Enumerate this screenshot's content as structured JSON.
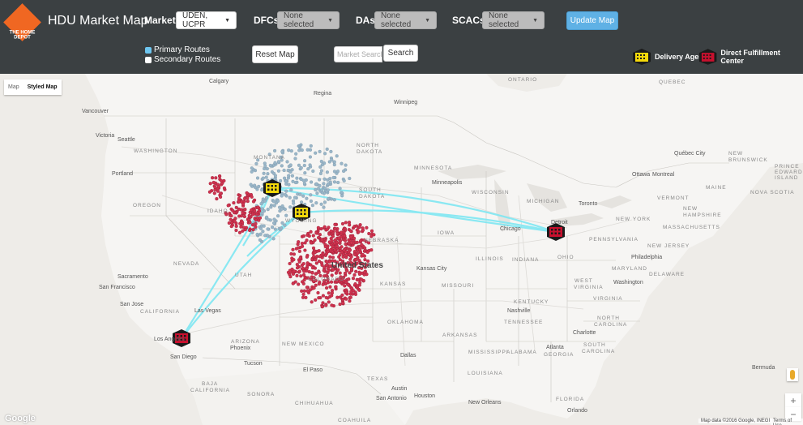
{
  "app": {
    "title": "HDU Market Map",
    "logo_text": "THE HOME DEPOT"
  },
  "filters": {
    "markets_label": "Markets:",
    "markets_value": "UDEN, UCPR",
    "dfcs_label": "DFCs:",
    "dfcs_value": "None selected",
    "das_label": "DAs:",
    "das_value": "None selected",
    "scacs_label": "SCACs:",
    "scacs_value": "None selected",
    "update_label": "Update Map"
  },
  "routes": {
    "primary_label": "Primary Routes",
    "secondary_label": "Secondary Routes",
    "primary_checked": true,
    "secondary_checked": false
  },
  "buttons": {
    "reset_label": "Reset Map",
    "search_label": "Search"
  },
  "search": {
    "placeholder": "Market Search"
  },
  "legend": {
    "delivery_agent": "Delivery Agent",
    "dfc": "Direct Fulfillment Center",
    "delivery_agent_color": "#f5d90a",
    "dfc_color": "#c8102e"
  },
  "map": {
    "type_map": "Map",
    "type_styled": "Styled Map",
    "zoom_in": "+",
    "zoom_out": "−",
    "attribution": "Map data ©2016 Google, INEGI",
    "terms": "Terms of Use",
    "google": "Google",
    "colors": {
      "primary_route": "#7fe7f2",
      "market_red": "#d0334f",
      "market_blue": "#9ab6c8",
      "water": "#eeece8"
    },
    "labels": {
      "calgary": "Calgary",
      "regina": "Regina",
      "winnipeg": "Winnipeg",
      "ontario": "ONTARIO",
      "quebec": "QUEBEC",
      "vancouver": "Vancouver",
      "victoria": "Victoria",
      "seattle": "Seattle",
      "washington": "WASHINGTON",
      "montana": "MONTANA",
      "north_dakota_1": "NORTH",
      "north_dakota_2": "DAKOTA",
      "minnesota": "MINNESOTA",
      "quebec_city": "Québec City",
      "new_brunswick_1": "NEW",
      "new_brunswick_2": "BRUNSWICK",
      "portland": "Portland",
      "oregon": "OREGON",
      "minneapolis": "Minneapolis",
      "wisconsin": "WISCONSIN",
      "ottawa": "Ottawa",
      "montreal": "Montreal",
      "maine": "MAINE",
      "pei_1": "PRINCE",
      "pei_2": "EDWARD",
      "pei_3": "ISLAND",
      "nova_scotia": "NOVA SCOTIA",
      "idaho": "IDAHO",
      "south_dakota_1": "SOUTH",
      "south_dakota_2": "DAKOTA",
      "michigan": "MICHIGAN",
      "toronto": "Toronto",
      "vermont": "VERMONT",
      "new_hampshire_1": "NEW",
      "new_hampshire_2": "HAMPSHIRE",
      "new_york": "NEW YORK",
      "wyoming": "WYOMING",
      "iowa": "IOWA",
      "chicago": "Chicago",
      "detroit": "Detroit",
      "massachusetts": "MASSACHUSETTS",
      "nebraska": "NEBRASKA",
      "pennsylvania": "PENNSYLVANIA",
      "new_jersey": "NEW JERSEY",
      "philadelphia": "Philadelphia",
      "nevada": "NEVADA",
      "utah": "UTAH",
      "united_states": "United States",
      "illinois": "ILLINOIS",
      "indiana": "INDIANA",
      "ohio": "OHIO",
      "colorado": "COLORADO",
      "kansas_city": "Kansas City",
      "maryland": "MARYLAND",
      "delaware": "DELAWARE",
      "sacramento": "Sacramento",
      "san_francisco": "San Francisco",
      "washington_dc": "Washington",
      "kansas": "KANSAS",
      "missouri": "MISSOURI",
      "west_virginia_1": "WEST",
      "west_virginia_2": "VIRGINIA",
      "san_jose": "San Jose",
      "virginia": "VIRGINIA",
      "california": "CALIFORNIA",
      "las_vegas": "Las Vegas",
      "kentucky": "KENTUCKY",
      "nashville": "Nashville",
      "tennessee": "TENNESSEE",
      "oklahoma": "OKLAHOMA",
      "north_carolina_1": "NORTH",
      "north_carolina_2": "CAROLINA",
      "charlotte": "Charlotte",
      "los_angeles": "Los Angeles",
      "arizona": "ARIZONA",
      "arkansas": "ARKANSAS",
      "phoenix": "Phoenix",
      "south_carolina_1": "SOUTH",
      "south_carolina_2": "CAROLINA",
      "san_diego": "San Diego",
      "new_mexico": "NEW MEXICO",
      "atlanta": "Atlanta",
      "mississippi": "MISSISSIPPI",
      "alabama": "ALABAMA",
      "georgia": "GEORGIA",
      "dallas": "Dallas",
      "tucson": "Tucson",
      "el_paso": "El Paso",
      "louisiana": "LOUISIANA",
      "texas": "TEXAS",
      "baja_1": "BAJA",
      "baja_2": "CALIFORNIA",
      "sonora": "SONORA",
      "chihuahua": "CHIHUAHUA",
      "austin": "Austin",
      "houston": "Houston",
      "new_orleans": "New Orleans",
      "san_antonio": "San Antonio",
      "florida": "FLORIDA",
      "orlando": "Orlando",
      "coahuila": "COAHUILA",
      "bermuda": "Bermuda"
    }
  }
}
